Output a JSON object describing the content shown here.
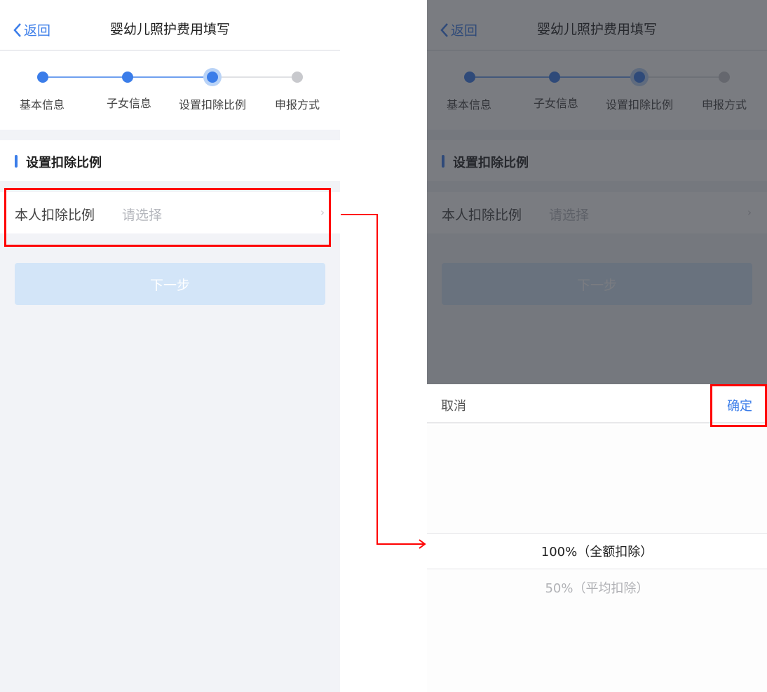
{
  "header": {
    "back_label": "返回",
    "title": "婴幼儿照护费用填写"
  },
  "steps": [
    {
      "label": "基本信息",
      "state": "done"
    },
    {
      "label": "子女信息",
      "state": "done"
    },
    {
      "label": "设置扣除比例",
      "state": "current"
    },
    {
      "label": "申报方式",
      "state": "todo"
    }
  ],
  "section": {
    "title": "设置扣除比例"
  },
  "form": {
    "ratio_label": "本人扣除比例",
    "ratio_placeholder": "请选择"
  },
  "next_label": "下一步",
  "picker": {
    "cancel_label": "取消",
    "confirm_label": "确定",
    "options": [
      "100%（全额扣除）",
      "50%（平均扣除）"
    ],
    "selected": "100%（全额扣除）"
  },
  "colors": {
    "accent": "#3b7de9",
    "highlight": "#ff0000"
  }
}
